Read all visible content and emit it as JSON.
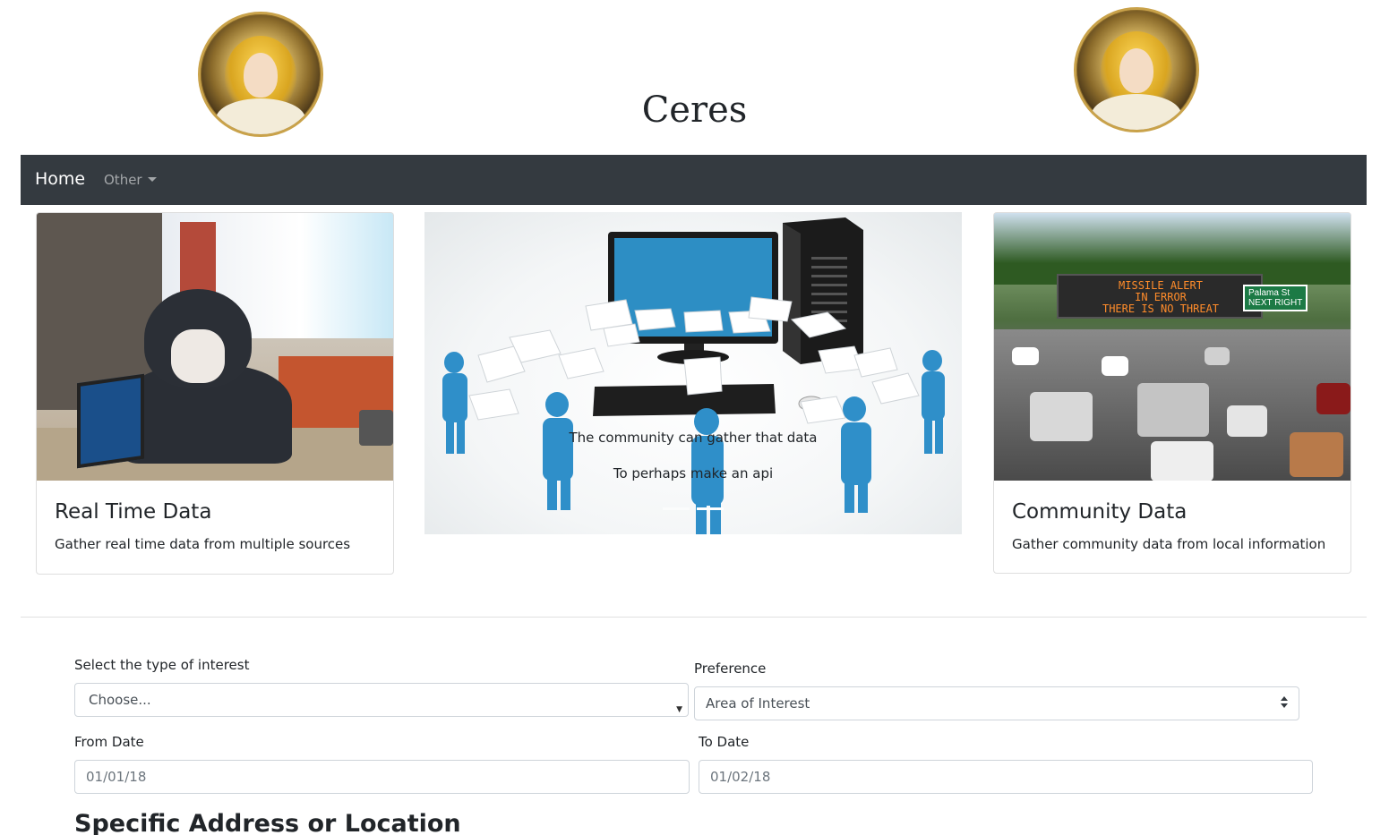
{
  "header": {
    "title": "Ceres",
    "logo_left_icon": "ceres-portrait-icon",
    "logo_right_icon": "ceres-portrait-icon"
  },
  "navbar": {
    "home_label": "Home",
    "other_label": "Other",
    "background": "#343a40"
  },
  "cards": {
    "left": {
      "title": "Real Time Data",
      "text": "Gather real time data from multiple sources"
    },
    "right": {
      "title": "Community Data",
      "text": "Gather community data from local information",
      "sign_line1": "MISSILE ALERT",
      "sign_line2": "IN ERROR",
      "sign_line3": "THERE IS NO THREAT",
      "road_sign_text": "Palama St",
      "road_sign_sub": "NEXT RIGHT"
    }
  },
  "carousel": {
    "caption_line1": "The community can gather that data",
    "caption_line2": "To perhaps make an api",
    "slide_count": 2,
    "active_slide": 2
  },
  "form": {
    "interest_label": "Select the type of interest",
    "interest_value": "Choose...",
    "preference_label": "Preference",
    "preference_value": "Area of Interest",
    "from_label": "From Date",
    "from_value": "01/01/18",
    "to_label": "To Date",
    "to_value": "01/02/18",
    "section_heading": "Specific Address or Location"
  }
}
